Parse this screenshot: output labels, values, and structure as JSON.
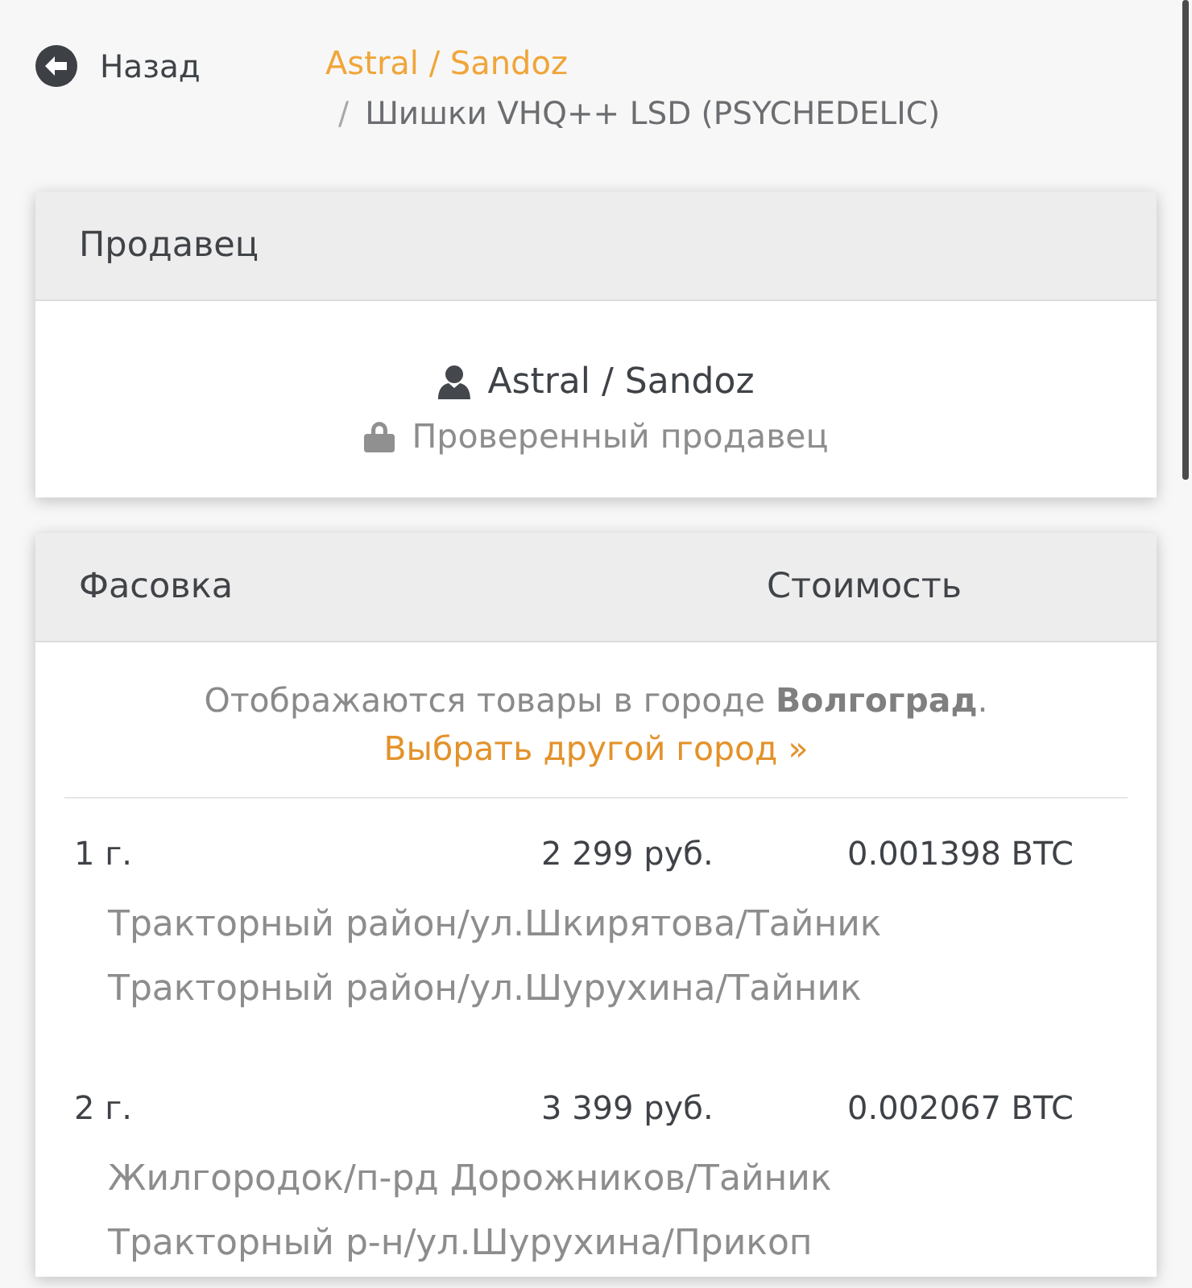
{
  "back_button": {
    "label": "Назад"
  },
  "breadcrumb": {
    "separator": "/",
    "items": [
      {
        "label": "Astral / Sandoz",
        "kind": "link"
      },
      {
        "label": "Шишки VHQ++ LSD (PSYCHEDELIC)",
        "kind": "current"
      }
    ]
  },
  "seller_card": {
    "title": "Продавец",
    "name": "Astral / Sandoz",
    "status": "Проверенный продавец"
  },
  "offers_card": {
    "columns": [
      "Фасовка",
      "Стоимость"
    ],
    "notice": "Отображаются товары в городе **Волгоград**.",
    "change_city_link": "Выбрать другой город »",
    "offers": [
      {
        "weight": "1 г.",
        "price_rub": "2 299 руб.",
        "price_btc": "0.001398 BTC",
        "locations": [
          "Тракторный район/ул.Шкирятова/Тайник",
          "Тракторный район/ул.Шурухина/Тайник"
        ]
      },
      {
        "weight": "2 г.",
        "price_rub": "3 399 руб.",
        "price_btc": "0.002067 BTC",
        "locations": [
          "Жилгородок/п-рд Дорожников/Тайник",
          "Тракторный р-н/ул.Шурухина/Прикоп"
        ]
      }
    ]
  }
}
